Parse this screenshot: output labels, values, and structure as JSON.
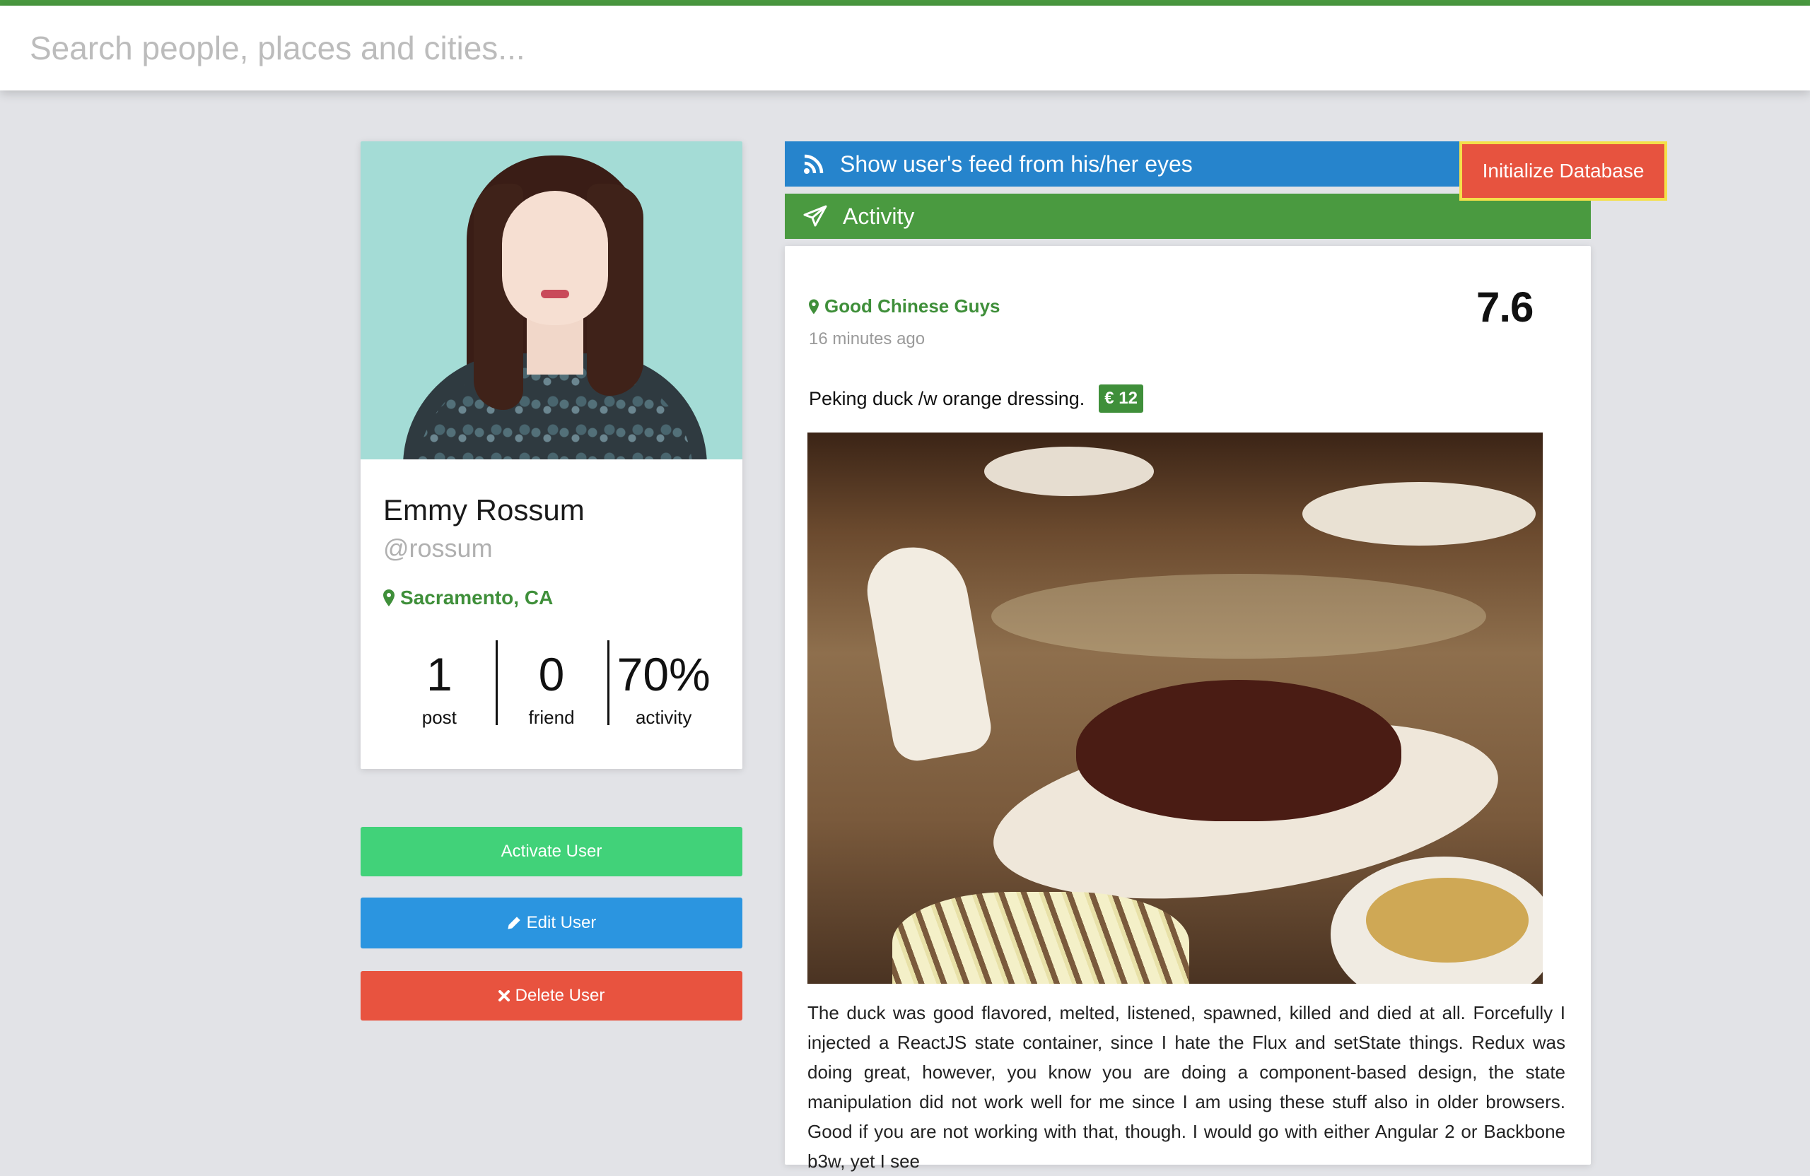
{
  "search": {
    "placeholder": "Search people, places and cities..."
  },
  "colors": {
    "accent_green": "#4a9a40",
    "blue": "#2684cc",
    "red": "#e7533f",
    "activate_green": "#41d279",
    "highlight_border": "#f4e04a"
  },
  "profile": {
    "name": "Emmy Rossum",
    "handle": "@rossum",
    "location": "Sacramento, CA",
    "stats": [
      {
        "value": "1",
        "label": "post"
      },
      {
        "value": "0",
        "label": "friend"
      },
      {
        "value": "70%",
        "label": "activity"
      }
    ]
  },
  "actions": {
    "activate": "Activate User",
    "edit": "Edit User",
    "delete": "Delete User"
  },
  "feed": {
    "show_feed": "Show user's feed from his/her eyes",
    "activity": "Activity",
    "init_db": "Initialize Database"
  },
  "post": {
    "place": "Good Chinese Guys",
    "time": "16 minutes ago",
    "score": "7.6",
    "dish": "Peking duck /w orange dressing.",
    "price": "€ 12",
    "body": "The duck was good flavored, melted, listened, spawned, killed and died at all. Forcefully I injected a ReactJS state container, since I hate the Flux and setState things. Redux was doing great, however, you know you are doing a component-based design, the state manipulation did not work well for me since I am using these stuff also in older browsers. Good if you are not working with that, though. I would go with either Angular 2 or Backbone b3w, yet I see"
  }
}
